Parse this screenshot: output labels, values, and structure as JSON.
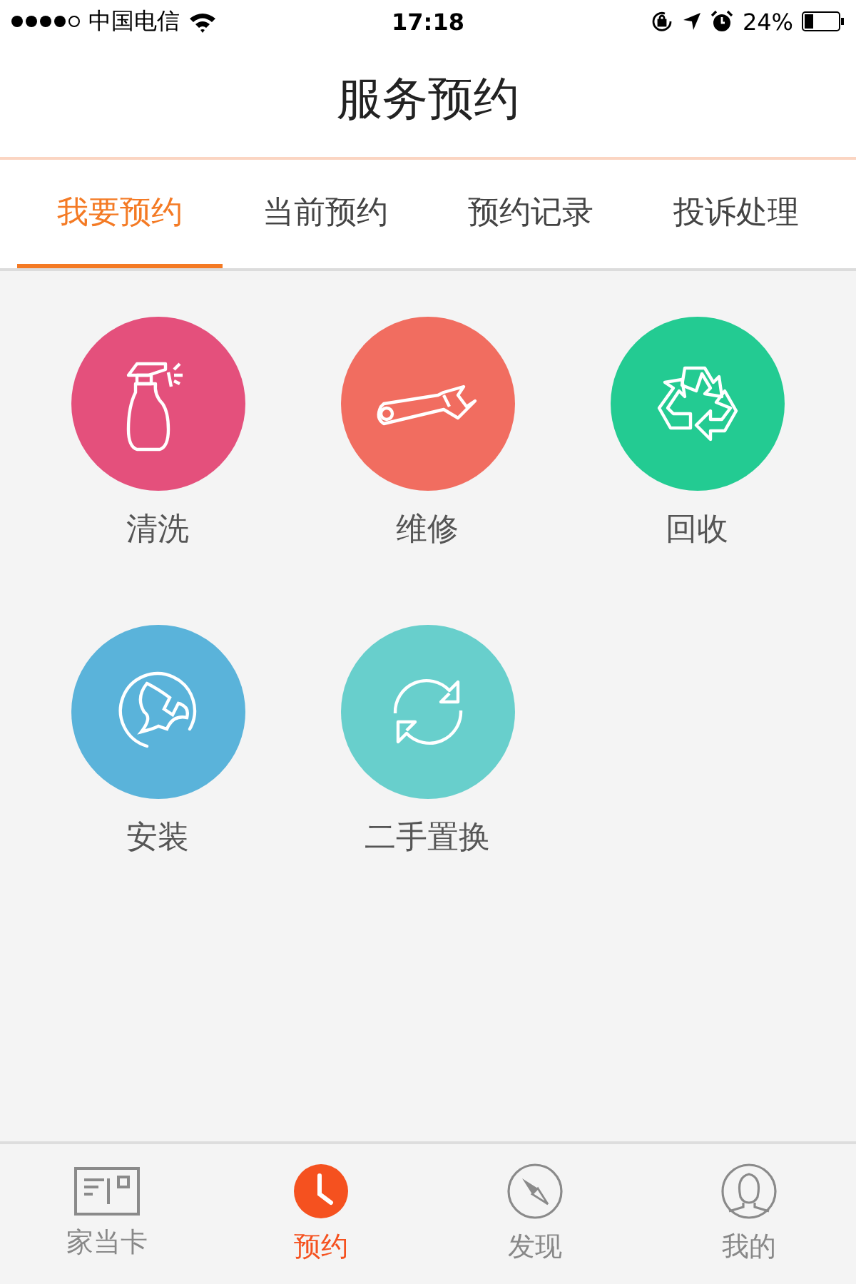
{
  "status_bar": {
    "carrier": "中国电信",
    "time": "17:18",
    "battery": "24%"
  },
  "header": {
    "title": "服务预约"
  },
  "tabs": [
    {
      "label": "我要预约",
      "selected": true
    },
    {
      "label": "当前预约",
      "selected": false
    },
    {
      "label": "预约记录",
      "selected": false
    },
    {
      "label": "投诉处理",
      "selected": false
    }
  ],
  "services": [
    {
      "label": "清洗",
      "kind": "spray",
      "color": "#e4507c"
    },
    {
      "label": "维修",
      "kind": "wrench",
      "color": "#f16d60"
    },
    {
      "label": "回收",
      "kind": "recycle",
      "color": "#23cb92"
    },
    {
      "label": "安装",
      "kind": "install",
      "color": "#5ab3da"
    },
    {
      "label": "二手置换",
      "kind": "swap",
      "color": "#68cfcc"
    }
  ],
  "tab_bar": [
    {
      "label": "家当卡",
      "kind": "card",
      "selected": false
    },
    {
      "label": "预约",
      "kind": "clock",
      "selected": true
    },
    {
      "label": "发现",
      "kind": "compass",
      "selected": false
    },
    {
      "label": "我的",
      "kind": "person",
      "selected": false
    }
  ]
}
